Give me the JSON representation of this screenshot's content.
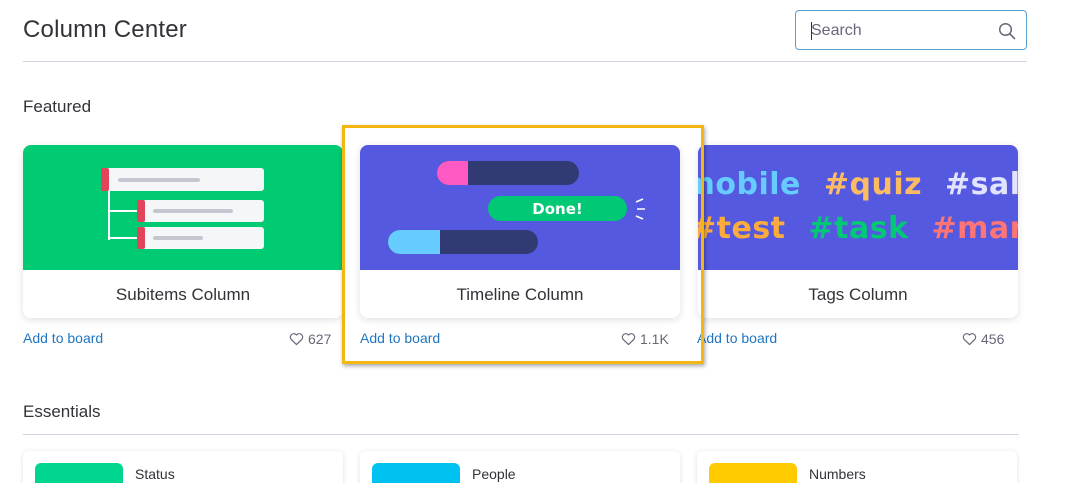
{
  "header": {
    "title": "Column Center",
    "search_placeholder": "Search"
  },
  "sections": {
    "featured": "Featured",
    "essentials": "Essentials"
  },
  "featured": [
    {
      "name": "Subitems Column",
      "action": "Add to board",
      "likes": "627",
      "banner_color": "#00ca72"
    },
    {
      "name": "Timeline Column",
      "action": "Add to board",
      "likes": "1.1K",
      "banner_color": "#5559df",
      "badge": "Done!"
    },
    {
      "name": "Tags Column",
      "action": "Add to board",
      "likes": "456",
      "banner_color": "#5559df",
      "tags_row1": [
        {
          "text": "#mobile",
          "color": "#66ccff"
        },
        {
          "text": "#quiz",
          "color": "#fdbc64"
        },
        {
          "text": "#sales",
          "color": "#e2e4ff"
        }
      ],
      "tags_row2": [
        {
          "text": "#test",
          "color": "#fdab3d"
        },
        {
          "text": "#task",
          "color": "#00c875"
        },
        {
          "text": "#marketing",
          "color": "#ff7575"
        }
      ]
    }
  ],
  "essentials": [
    {
      "name": "Status",
      "thumb_color": "#00d68f"
    },
    {
      "name": "People",
      "thumb_color": "#00c2f0"
    },
    {
      "name": "Numbers",
      "thumb_color": "#ffcb00"
    }
  ],
  "colors": {
    "link": "#1f76c2",
    "highlight": "#f2b713",
    "divider": "#d0d4e4"
  }
}
